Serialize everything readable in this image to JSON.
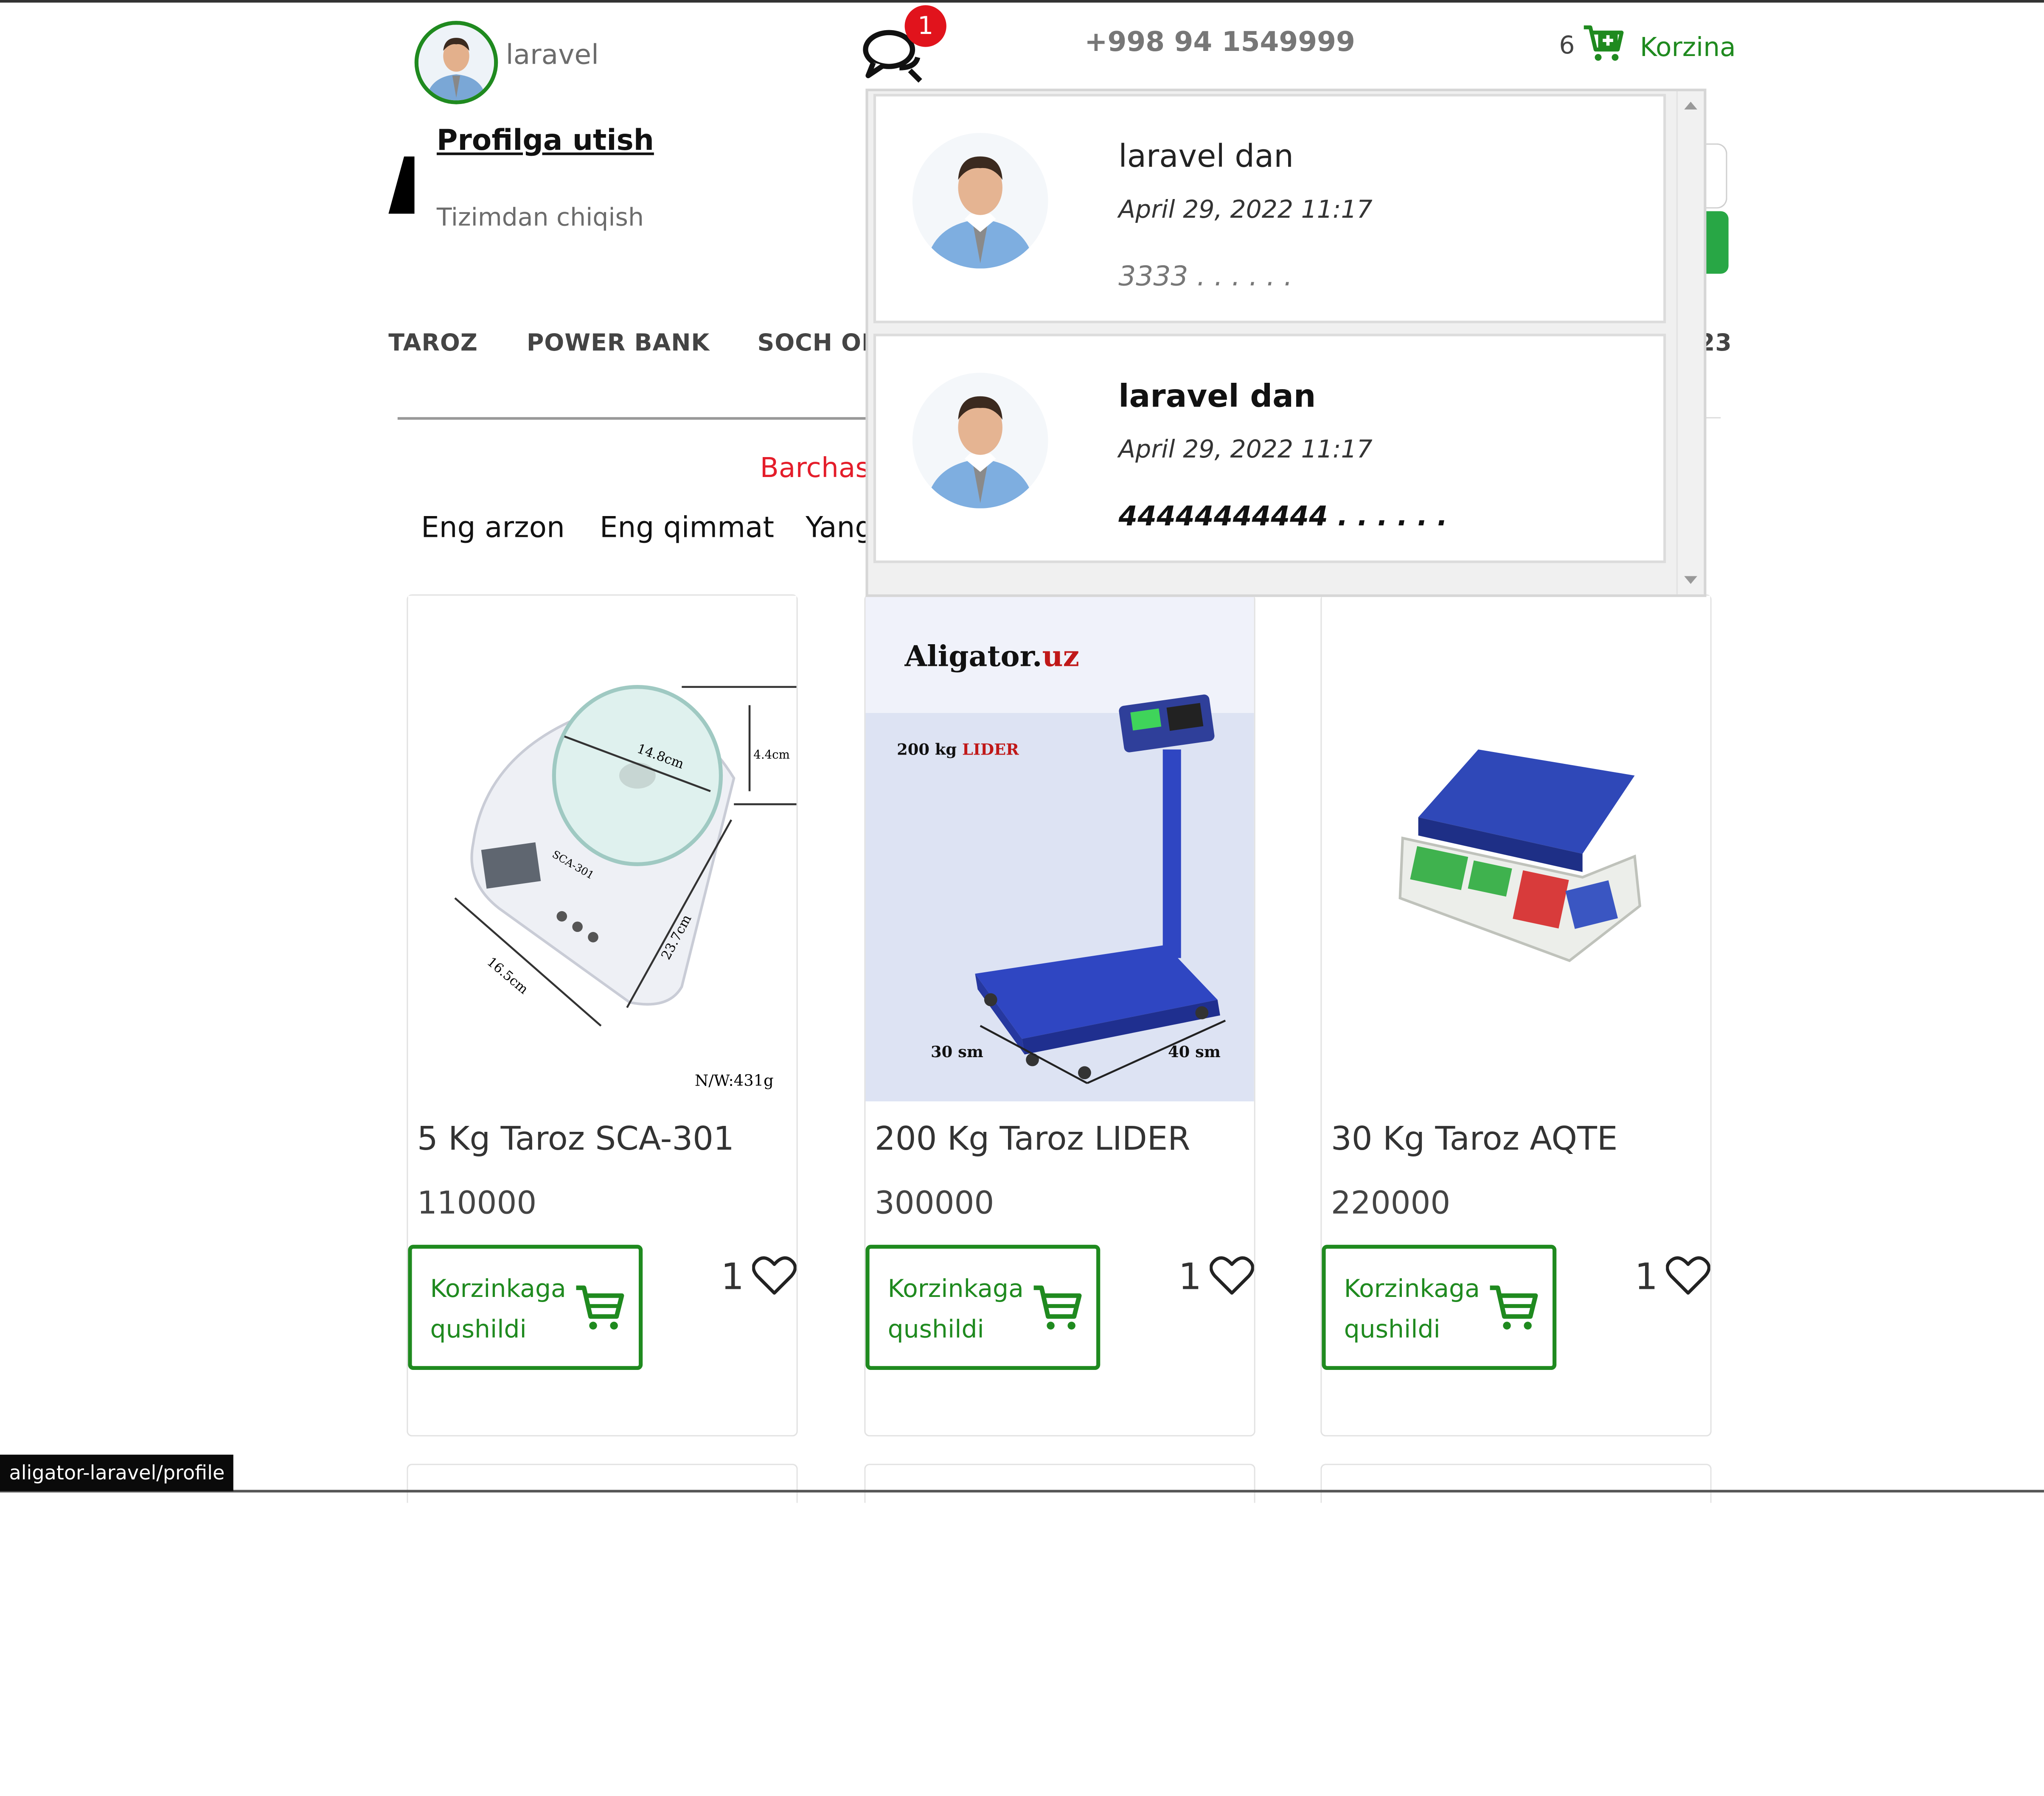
{
  "header": {
    "user_name": "laravel",
    "profile_link": "Profilga utish",
    "logout_link": "Tizimdan chiqish",
    "notifications_count": "1",
    "phone": "+998 94 1549999",
    "cart_count": "6",
    "cart_label": "Korzina"
  },
  "nav": {
    "categories": [
      "TAROZ",
      "POWER BANK",
      "SOCH OL",
      "23"
    ]
  },
  "filters": {
    "all_label": "Barchasi",
    "sort": [
      "Eng arzon",
      "Eng qimmat",
      "Yang"
    ]
  },
  "messages": [
    {
      "from": "laravel dan",
      "date": "April 29, 2022 11:17",
      "text": "3333 . . . . . .",
      "unread": false
    },
    {
      "from": "laravel dan",
      "date": "April 29, 2022 11:17",
      "text": "44444444444 . . . . . .",
      "unread": true
    }
  ],
  "products": [
    {
      "title": "5 Kg Taroz SCA-301",
      "price": "110000",
      "button_label": "Korzinkaga qushildi",
      "likes": "1",
      "image_labels": {
        "diameter": "14.8cm",
        "height": "4.4cm",
        "width": "16.5cm",
        "length": "23.7cm",
        "model": "SCA-301",
        "weight": "N/W:431g"
      }
    },
    {
      "title": "200 Kg Taroz LIDER",
      "price": "300000",
      "button_label": "Korzinkaga qushildi",
      "likes": "1",
      "image_labels": {
        "brand_main": "Aligator.",
        "brand_suffix": "uz",
        "capacity": "200 kg",
        "model": "LIDER",
        "dim_left": "30 sm",
        "dim_right": "40 sm"
      }
    },
    {
      "title": "30 Kg Taroz AQTE",
      "price": "220000",
      "button_label": "Korzinkaga qushildi",
      "likes": "1"
    }
  ],
  "status_bar": {
    "url": "aligator-laravel/profile"
  },
  "colors": {
    "accent_green": "#1f8a1f",
    "badge_red": "#e1131c",
    "link_red": "#e41d2a",
    "button_green": "#28a745"
  }
}
